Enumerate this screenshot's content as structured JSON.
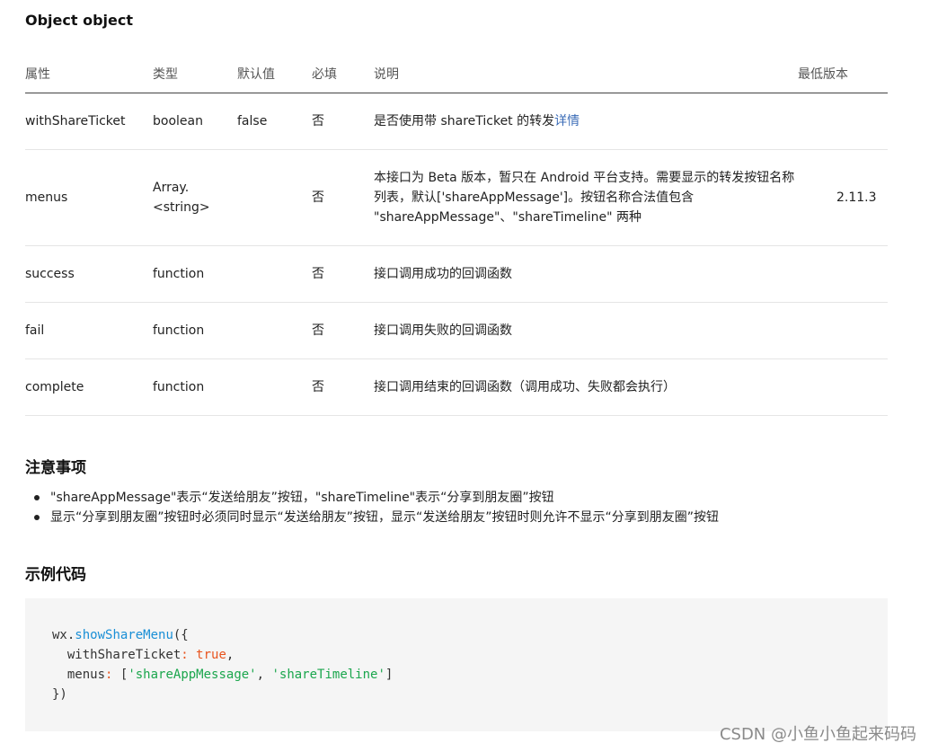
{
  "object_title": "Object object",
  "table": {
    "headers": {
      "name": "属性",
      "type": "类型",
      "default": "默认值",
      "required": "必填",
      "desc": "说明",
      "version": "最低版本"
    },
    "rows": [
      {
        "name": "withShareTicket",
        "type": "boolean",
        "default": "false",
        "required": "否",
        "desc": "是否使用带 shareTicket 的转发",
        "desc_link": "详情",
        "version": ""
      },
      {
        "name": "menus",
        "type_line1": "Array.",
        "type_line2": "<string>",
        "default": "",
        "required": "否",
        "desc_line1": "本接口为 Beta 版本，暂只在 Android 平台支持。需要显示的转发按钮名称",
        "desc_line2": "列表，默认['shareAppMessage']。按钮名称合法值包含",
        "desc_line3": "\"shareAppMessage\"、\"shareTimeline\" 两种",
        "version": "2.11.3"
      },
      {
        "name": "success",
        "type": "function",
        "default": "",
        "required": "否",
        "desc": "接口调用成功的回调函数",
        "version": ""
      },
      {
        "name": "fail",
        "type": "function",
        "default": "",
        "required": "否",
        "desc": "接口调用失败的回调函数",
        "version": ""
      },
      {
        "name": "complete",
        "type": "function",
        "default": "",
        "required": "否",
        "desc": "接口调用结束的回调函数（调用成功、失败都会执行）",
        "version": ""
      }
    ]
  },
  "notes": {
    "title": "注意事项",
    "items": [
      "\"shareAppMessage\"表示“发送给朋友”按钮，\"shareTimeline\"表示“分享到朋友圈”按钮",
      "显示“分享到朋友圈”按钮时必须同时显示“发送给朋友”按钮，显示“发送给朋友”按钮时则允许不显示“分享到朋友圈”按钮"
    ]
  },
  "example": {
    "title": "示例代码",
    "code": {
      "l1_obj": "wx",
      "l1_dot": ".",
      "l1_fn": "showShareMenu",
      "l1_open": "({",
      "l2_key": "  withShareTicket",
      "l2_colon": ":",
      "l2_val": "true",
      "l2_comma": ",",
      "l3_key": "  menus",
      "l3_colon": ":",
      "l3_open": " [",
      "l3_s1": "'shareAppMessage'",
      "l3_sep": ", ",
      "l3_s2": "'shareTimeline'",
      "l3_close": "]",
      "l4": "})"
    }
  },
  "watermark": "CSDN @小鱼小鱼起来码码",
  "colors": {
    "link": "#3b6cb7",
    "version": "#3b5998",
    "code_fn": "#1a8fd6",
    "code_keyword": "#e8541e",
    "code_string": "#1ba64d",
    "code_bg": "#f5f5f5"
  }
}
